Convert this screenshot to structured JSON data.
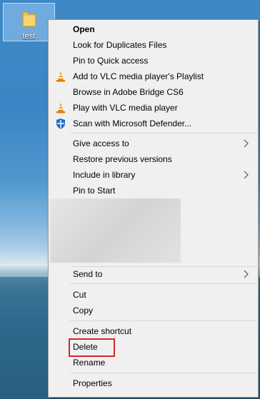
{
  "desktop": {
    "folder_label": "test"
  },
  "menu": {
    "group1": [
      {
        "label": "Open",
        "bold": true,
        "icon": ""
      },
      {
        "label": "Look for Duplicates Files",
        "icon": ""
      },
      {
        "label": "Pin to Quick access",
        "icon": ""
      },
      {
        "label": "Add to VLC media player's Playlist",
        "icon": "vlc-cone-icon"
      },
      {
        "label": "Browse in Adobe Bridge CS6",
        "icon": ""
      },
      {
        "label": "Play with VLC media player",
        "icon": "vlc-cone-icon"
      },
      {
        "label": "Scan with Microsoft Defender...",
        "icon": "defender-shield-icon"
      }
    ],
    "group2": [
      {
        "label": "Give access to",
        "submenu": true
      },
      {
        "label": "Restore previous versions"
      },
      {
        "label": "Include in library",
        "submenu": true
      },
      {
        "label": "Pin to Start"
      }
    ],
    "group3": [
      {
        "label": "Send to",
        "submenu": true
      }
    ],
    "group4": [
      {
        "label": "Cut"
      },
      {
        "label": "Copy"
      }
    ],
    "group5": [
      {
        "label": "Create shortcut"
      },
      {
        "label": "Delete",
        "highlighted": true
      },
      {
        "label": "Rename"
      }
    ],
    "group6": [
      {
        "label": "Properties"
      }
    ]
  },
  "colors": {
    "menu_background": "#f0f0f0",
    "highlight_border": "#d6262b",
    "vlc_orange": "#f48b00"
  }
}
